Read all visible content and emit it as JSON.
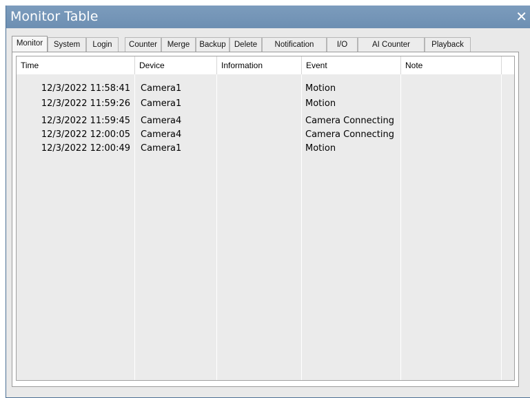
{
  "window": {
    "title": "Monitor Table",
    "close_glyph": "✕"
  },
  "tabs": [
    "Monitor",
    "System",
    "Login",
    "Counter",
    "Merge",
    "Backup",
    "Delete",
    "Notification",
    "I/O",
    "AI Counter",
    "Playback"
  ],
  "active_tab": "Monitor",
  "table": {
    "columns": [
      "Time",
      "Device",
      "Information",
      "Event",
      "Note"
    ],
    "rows": [
      [
        "12/3/2022 11:58:41",
        "Camera1",
        "",
        "Motion",
        ""
      ],
      [
        "12/3/2022 11:59:26",
        "Camera1",
        "",
        "Motion",
        ""
      ],
      [
        "12/3/2022 11:59:45",
        "Camera4",
        "",
        "Camera Connecting",
        ""
      ],
      [
        "12/3/2022 12:00:05",
        "Camera4",
        "",
        "Camera Connecting",
        ""
      ],
      [
        "12/3/2022 12:00:49",
        "Camera1",
        "",
        "Motion",
        ""
      ]
    ]
  }
}
